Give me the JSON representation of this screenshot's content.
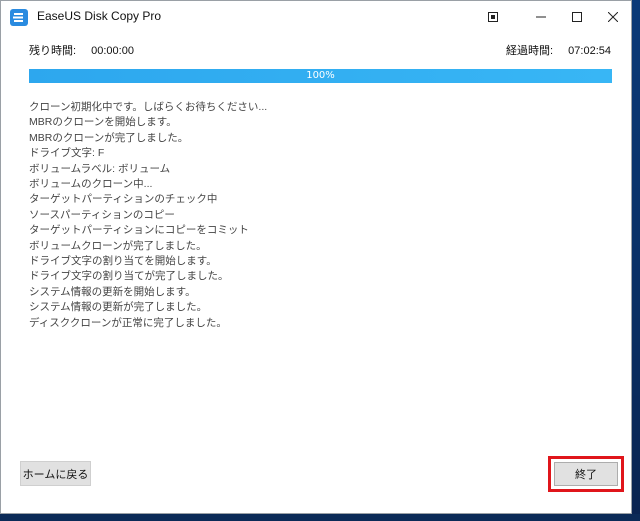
{
  "window": {
    "title": "EaseUS Disk Copy Pro",
    "accent": "#2ba9f0"
  },
  "icons": {
    "app": "easeus-app-icon",
    "restore": "pin-icon",
    "minimize": "minimize-icon",
    "maximize": "maximize-icon",
    "close": "close-icon"
  },
  "status": {
    "remaining_label": "残り時間:",
    "remaining_value": "00:00:00",
    "elapsed_label": "経過時間:",
    "elapsed_value": "07:02:54"
  },
  "progress": {
    "percent": 100,
    "label": "100%"
  },
  "log": [
    "クローン初期化中です。しばらくお待ちください...",
    "MBRのクローンを開始します。",
    "MBRのクローンが完了しました。",
    "ドライブ文字: F",
    "ボリュームラベル: ボリューム",
    "ボリュームのクローン中...",
    "ターゲットパーティションのチェック中",
    "ソースパーティションのコピー",
    "ターゲットパーティションにコピーをコミット",
    "ボリュームクローンが完了しました。",
    "ドライブ文字の割り当てを開始します。",
    "ドライブ文字の割り当てが完了しました。",
    "システム情報の更新を開始します。",
    "システム情報の更新が完了しました。",
    "ディスククローンが正常に完了しました。"
  ],
  "buttons": {
    "home": "ホームに戻る",
    "finish": "終了"
  }
}
